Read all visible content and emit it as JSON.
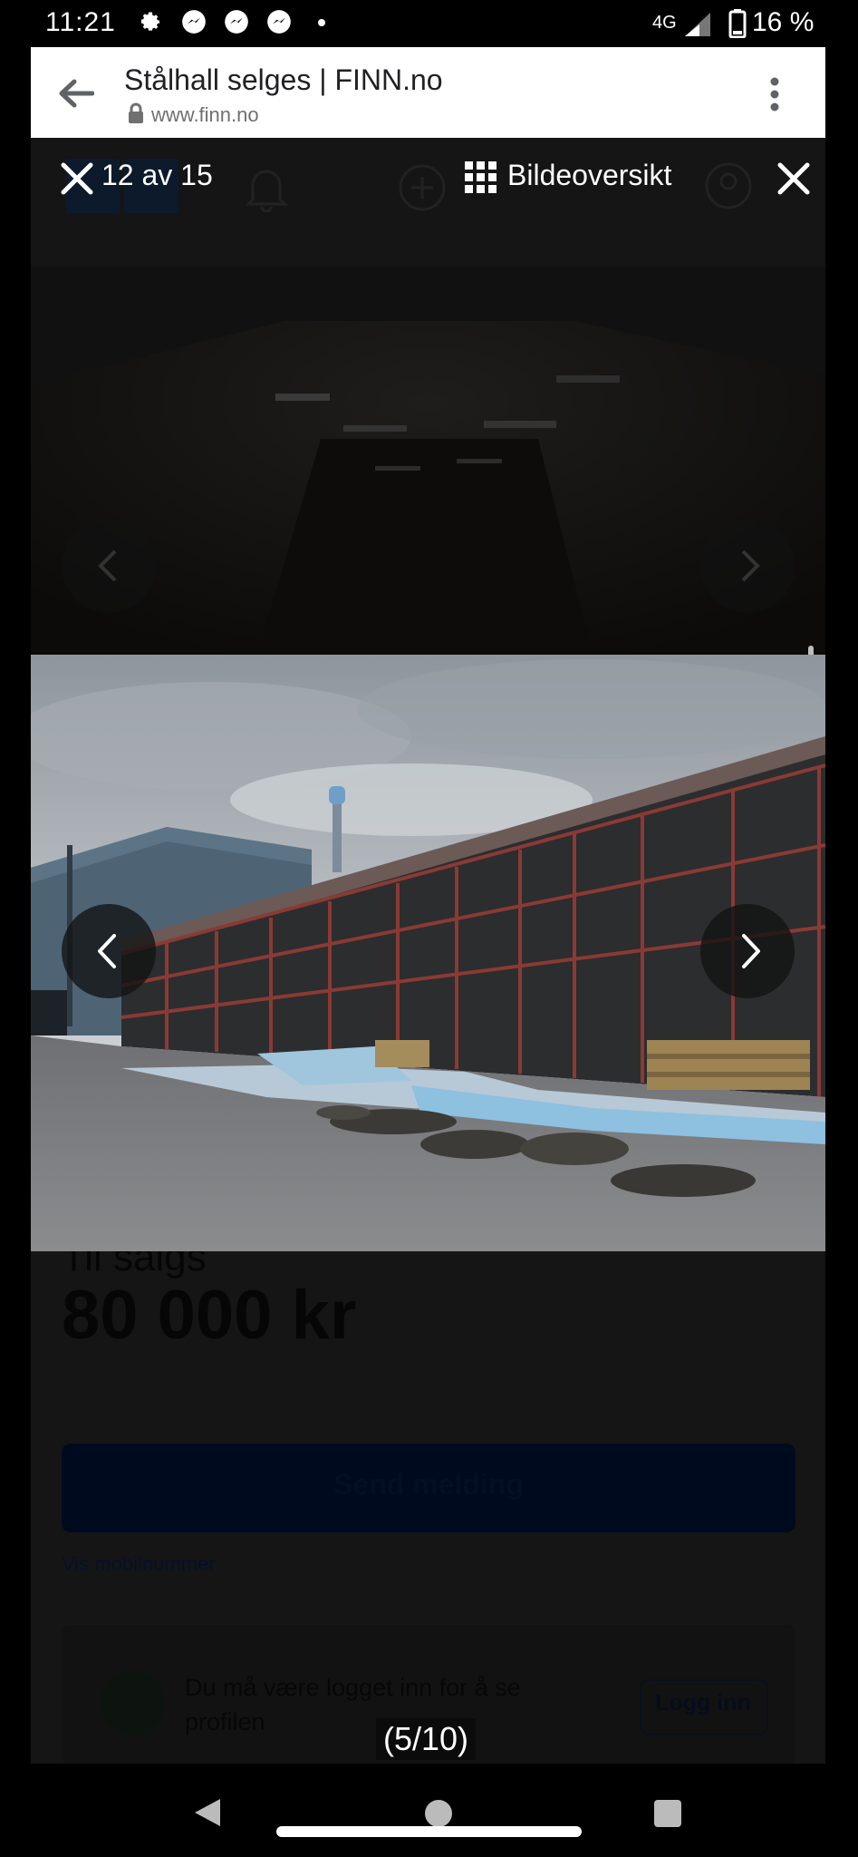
{
  "status_bar": {
    "time": "11:21",
    "network": "4G",
    "battery": "16 %",
    "icons": [
      "gear-icon",
      "messenger-icon",
      "messenger-icon",
      "messenger-icon",
      "dot-icon",
      "signal-icon",
      "battery-icon"
    ]
  },
  "browser": {
    "title": "Stålhall selges | FINN.no",
    "url": "www.finn.no",
    "icons": [
      "back-arrow-icon",
      "lock-icon",
      "more-vert-icon"
    ]
  },
  "gallery": {
    "counter": "12 av 15",
    "overview_label": "Bildeoversikt",
    "caption": "(5/10)",
    "icons": [
      "close-icon",
      "grid-icon",
      "chevron-left-icon",
      "chevron-right-icon"
    ]
  },
  "background_page": {
    "price_label": "Til salgs",
    "price": "80 000 kr",
    "send_button": "Send melding",
    "phone_link": "Vis mobilnummer",
    "login_notice": "Du må være logget inn for å se profilen",
    "login_button": "Logg inn"
  },
  "colors": {
    "browser_bar": "#ffffff",
    "overlay": "#151515",
    "send_button": "#000a1f"
  },
  "system_nav": {
    "icons": [
      "nav-back-icon",
      "nav-home-icon",
      "nav-recents-icon"
    ]
  }
}
